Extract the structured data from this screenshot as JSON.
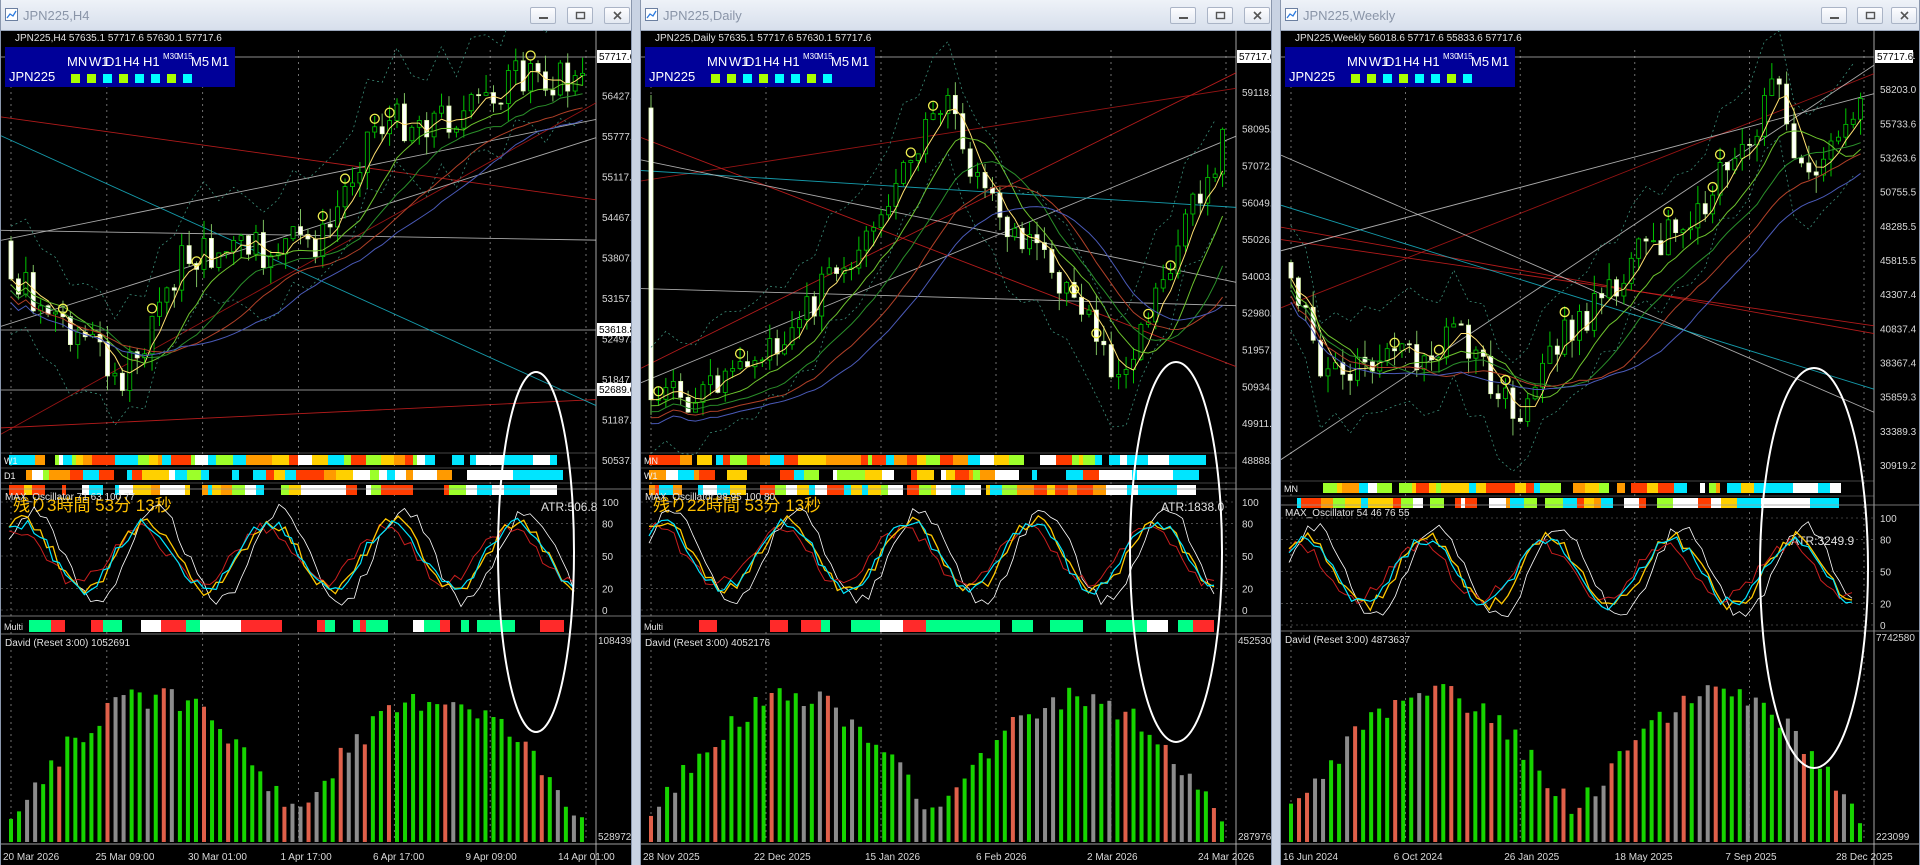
{
  "windows": [
    {
      "title": "JPN225,H4",
      "ohlc_header": "JPN225,H4  57635.1 57717.6 57630.1 57717.6",
      "symbol_box": "JPN225",
      "tf_labels": {
        "mn": "MN",
        "w1": "W1",
        "d1": "D1",
        "h4": "H4",
        "h1": "H1",
        "m30": "M30",
        "m15": "M15",
        "m5": "M5",
        "m1": "M1"
      },
      "timer": "残り3時間 53分 13秒",
      "atr": "ATR:506.8",
      "osc_label": "MAX_Oscillator 71 63 100 77",
      "multi_label": "Multi",
      "vol_label": "David (Reset 3:00) 1052691",
      "price_ticks": [
        "57087.0",
        "56427.0",
        "55777.0",
        "55117.0",
        "54467.0",
        "53807.0",
        "53157.0",
        "52497.0",
        "51847.0",
        "51187.0",
        "50537.0"
      ],
      "price_tags": [
        "57717.6",
        "53618.8",
        "52689.6"
      ],
      "osc_ticks": [
        "100",
        "80",
        "50",
        "20",
        "0"
      ],
      "vol_ticks": [
        "1084397",
        "528972"
      ],
      "time_ticks": [
        "20 Mar 2026",
        "25 Mar 09:00",
        "30 Mar 01:00",
        "1 Apr 17:00",
        "6 Apr 17:00",
        "9 Apr 09:00",
        "14 Apr 01:00"
      ],
      "strip_labels": [
        "W1",
        "D1",
        ""
      ]
    },
    {
      "title": "JPN225,Daily",
      "ohlc_header": "JPN225,Daily  57635.1 57717.6 57630.1 57717.6",
      "symbol_box": "JPN225",
      "tf_labels": {
        "mn": "MN",
        "w1": "W1",
        "d1": "D1",
        "h4": "H4",
        "h1": "H1",
        "m30": "M30",
        "m15": "M15",
        "m5": "M5",
        "m1": "M1"
      },
      "timer": "残り22時間 53分 13秒",
      "atr": "ATR:1838.0",
      "osc_label": "MAX_Oscillator 98 95 100 80",
      "multi_label": "Multi",
      "vol_label": "David (Reset 3:00) 4052176",
      "price_ticks": [
        "60141.5",
        "59118.5",
        "58095.5",
        "57072.5",
        "56049.5",
        "55026.5",
        "54003.5",
        "52980.5",
        "51957.5",
        "50934.5",
        "49911.5",
        "48888.5"
      ],
      "price_tags": [
        "57717.6"
      ],
      "osc_ticks": [
        "100",
        "80",
        "50",
        "20",
        "0"
      ],
      "vol_ticks": [
        "4525306",
        "2879763"
      ],
      "time_ticks": [
        "28 Nov 2025",
        "22 Dec 2025",
        "15 Jan 2026",
        "6 Feb 2026",
        "2 Mar 2026",
        "24 Mar 2026"
      ],
      "strip_labels": [
        "MN",
        "W1",
        ""
      ]
    },
    {
      "title": "JPN225,Weekly",
      "ohlc_header": "JPN225,Weekly  56018.6 57717.6 55833.6 57717.6",
      "symbol_box": "JPN225",
      "tf_labels": {
        "mn": "MN",
        "w1": "W1",
        "d1": "D1",
        "h4": "H4",
        "h1": "H1",
        "m30": "M30",
        "m15": "M15",
        "m5": "M5",
        "m1": "M1"
      },
      "timer": "",
      "atr": "ATR:3249.9",
      "osc_label": "MAX_Oscillator 54 46 76 55",
      "multi_label": "",
      "vol_label": "David (Reset 3:00) 4873637",
      "price_ticks": [
        "60711.1",
        "58203.0",
        "55733.6",
        "53263.6",
        "50755.5",
        "48285.5",
        "45815.5",
        "43307.4",
        "40837.4",
        "38367.4",
        "35859.3",
        "33389.3",
        "30919.2"
      ],
      "price_tags": [
        "57717.6"
      ],
      "osc_ticks": [
        "100",
        "80",
        "50",
        "20",
        "0"
      ],
      "vol_ticks": [
        "7742580",
        "223099"
      ],
      "time_ticks": [
        "16 Jun 2024",
        "6 Oct 2024",
        "26 Jan 2025",
        "18 May 2025",
        "7 Sep 2025",
        "28 Dec 2025"
      ],
      "strip_labels": [
        "MN",
        ""
      ]
    }
  ],
  "colors": {
    "bull": "#00c800",
    "bear": "#ffffff",
    "cyan": "#00e5ff",
    "osc_yellow": "#ffc800",
    "osc_red": "#c81e1e",
    "vol_green": "#17d400",
    "vol_gray": "#8c8c8c",
    "vol_red": "#e0604a",
    "timer": "#ffc000",
    "navy": "#000099"
  },
  "icons": {
    "minimize": "minimize-icon",
    "maximize": "maximize-icon",
    "close": "close-icon",
    "chart": "chart-window-icon"
  }
}
